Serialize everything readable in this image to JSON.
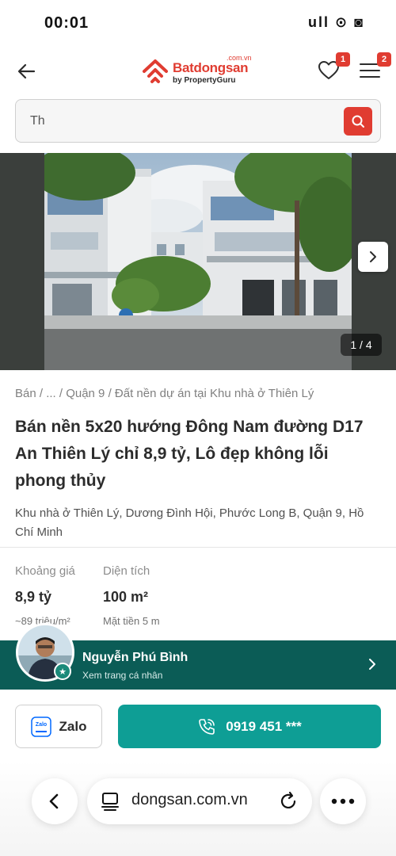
{
  "status_bar": {
    "time": "00:01",
    "icons": "ull ⊙ ◙"
  },
  "header": {
    "logo_text": "Batdongsan",
    "logo_domain": ".com.vn",
    "logo_sub": "by PropertyGuru",
    "favorites_badge": "1",
    "menu_badge": "2"
  },
  "search": {
    "value": "Th"
  },
  "gallery": {
    "counter": "1 / 4"
  },
  "listing": {
    "breadcrumb": "Bán / ... / Quận 9 / Đất nền dự án tại Khu nhà ở Thiên Lý",
    "title": "Bán nền 5x20 hướng Đông Nam đường D17 An Thiên Lý chỉ 8,9 tỷ, Lô đẹp không lỗi phong thủy",
    "address": "Khu nhà ở Thiên Lý, Dương Đình Hội, Phước Long B, Quận 9, Hồ Chí Minh"
  },
  "stats": {
    "price_label": "Khoảng giá",
    "price_value": "8,9 tỷ",
    "price_sub": "~89 triệu/m²",
    "area_label": "Diện tích",
    "area_value": "100 m²",
    "area_sub": "Mặt tiền 5 m"
  },
  "agent": {
    "name": "Nguyễn Phú Bình",
    "profile_link": "Xem trang cá nhân"
  },
  "actions": {
    "zalo_label": "Zalo",
    "zalo_icon_text": "Zalo",
    "phone_label": "0919 451 ***"
  },
  "browser": {
    "url": "dongsan.com.vn"
  },
  "colors": {
    "brand_red": "#e03c31",
    "teal": "#0e9e95",
    "agent_bar": "#0b5c56"
  }
}
